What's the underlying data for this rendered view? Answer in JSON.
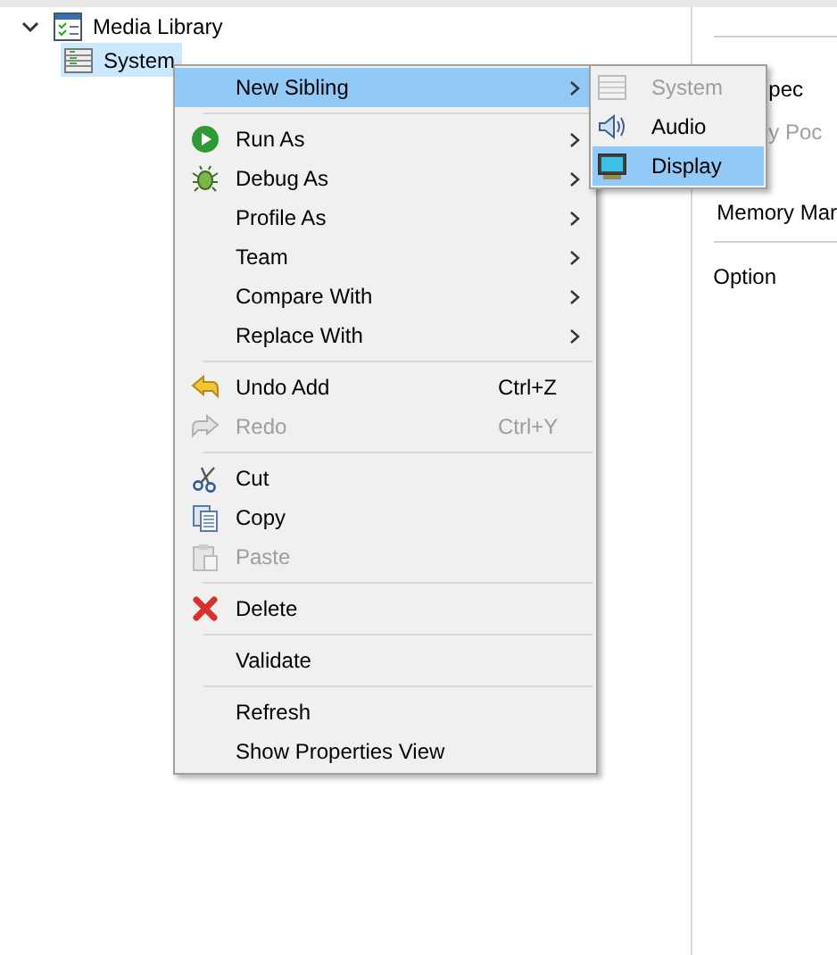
{
  "tree": [
    {
      "label": "Media Library",
      "expanded": true,
      "selected": false,
      "children": [
        {
          "label": "System",
          "selected": true
        }
      ]
    }
  ],
  "properties": {
    "lines": [
      {
        "text": "pec",
        "disabled": false
      },
      {
        "text": "y Poc",
        "disabled": true
      },
      {
        "text": "Memory Mar",
        "disabled": false
      }
    ],
    "section": "Option"
  },
  "context_menu": {
    "items": [
      {
        "kind": "item",
        "label": "New Sibling",
        "submenu": true,
        "selected": true,
        "disabled": false
      },
      {
        "kind": "separator"
      },
      {
        "kind": "item",
        "label": "Run As",
        "submenu": true,
        "selected": false,
        "disabled": false
      },
      {
        "kind": "item",
        "label": "Debug As",
        "submenu": true,
        "selected": false,
        "disabled": false
      },
      {
        "kind": "item",
        "label": "Profile As",
        "submenu": true,
        "selected": false,
        "disabled": false
      },
      {
        "kind": "item",
        "label": "Team",
        "submenu": true,
        "selected": false,
        "disabled": false
      },
      {
        "kind": "item",
        "label": "Compare With",
        "submenu": true,
        "selected": false,
        "disabled": false
      },
      {
        "kind": "item",
        "label": "Replace With",
        "submenu": true,
        "selected": false,
        "disabled": false
      },
      {
        "kind": "separator"
      },
      {
        "kind": "item",
        "label": "Undo Add",
        "shortcut": "Ctrl+Z",
        "submenu": false,
        "selected": false,
        "disabled": false
      },
      {
        "kind": "item",
        "label": "Redo",
        "shortcut": "Ctrl+Y",
        "submenu": false,
        "selected": false,
        "disabled": true
      },
      {
        "kind": "separator"
      },
      {
        "kind": "item",
        "label": "Cut",
        "submenu": false,
        "selected": false,
        "disabled": false
      },
      {
        "kind": "item",
        "label": "Copy",
        "submenu": false,
        "selected": false,
        "disabled": false
      },
      {
        "kind": "item",
        "label": "Paste",
        "submenu": false,
        "selected": false,
        "disabled": true
      },
      {
        "kind": "separator"
      },
      {
        "kind": "item",
        "label": "Delete",
        "submenu": false,
        "selected": false,
        "disabled": false
      },
      {
        "kind": "separator"
      },
      {
        "kind": "item",
        "label": "Validate",
        "submenu": false,
        "selected": false,
        "disabled": false
      },
      {
        "kind": "separator"
      },
      {
        "kind": "item",
        "label": "Refresh",
        "submenu": false,
        "selected": false,
        "disabled": false
      },
      {
        "kind": "item",
        "label": "Show Properties View",
        "submenu": false,
        "selected": false,
        "disabled": false
      }
    ]
  },
  "submenu": {
    "items": [
      {
        "label": "System",
        "disabled": true,
        "selected": false
      },
      {
        "label": "Audio",
        "disabled": false,
        "selected": false
      },
      {
        "label": "Display",
        "disabled": false,
        "selected": true
      }
    ]
  }
}
